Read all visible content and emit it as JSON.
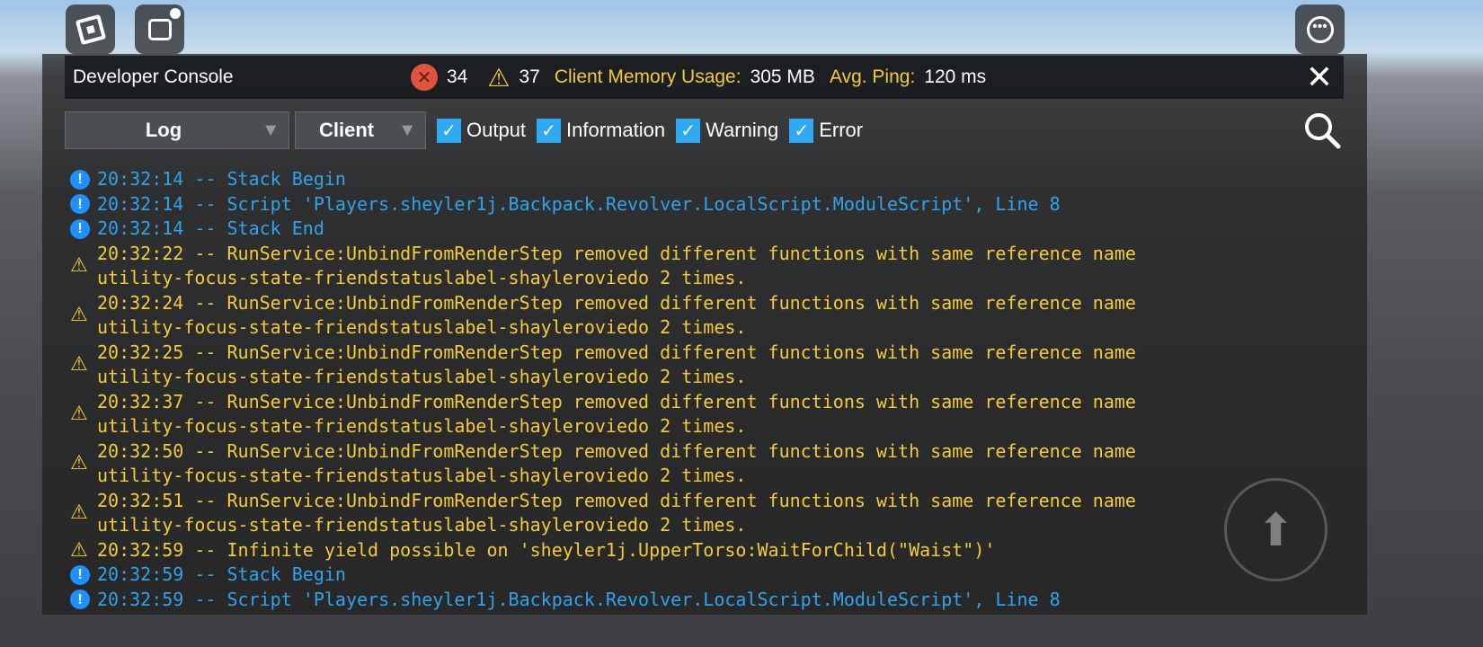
{
  "header": {
    "title": "Developer Console",
    "error_count": "34",
    "warning_count": "37",
    "memory_label": "Client Memory Usage:",
    "memory_value": "305 MB",
    "ping_label": "Avg. Ping:",
    "ping_value": "120 ms",
    "close": "✕"
  },
  "toolbar": {
    "view": "Log",
    "context": "Client",
    "filters": [
      "Output",
      "Information",
      "Warning",
      "Error"
    ]
  },
  "log": [
    {
      "type": "info",
      "lines": [
        "20:32:14 -- Stack Begin"
      ]
    },
    {
      "type": "info",
      "lines": [
        "20:32:14 -- Script 'Players.sheyler1j.Backpack.Revolver.LocalScript.ModuleScript', Line 8"
      ]
    },
    {
      "type": "info",
      "lines": [
        "20:32:14 -- Stack End"
      ]
    },
    {
      "type": "warn",
      "lines": [
        "20:32:22 -- RunService:UnbindFromRenderStep removed different functions with same reference name",
        "utility-focus-state-friendstatuslabel-shayleroviedo 2 times."
      ]
    },
    {
      "type": "warn",
      "lines": [
        "20:32:24 -- RunService:UnbindFromRenderStep removed different functions with same reference name",
        "utility-focus-state-friendstatuslabel-shayleroviedo 2 times."
      ]
    },
    {
      "type": "warn",
      "lines": [
        "20:32:25 -- RunService:UnbindFromRenderStep removed different functions with same reference name",
        "utility-focus-state-friendstatuslabel-shayleroviedo 2 times."
      ]
    },
    {
      "type": "warn",
      "lines": [
        "20:32:37 -- RunService:UnbindFromRenderStep removed different functions with same reference name",
        "utility-focus-state-friendstatuslabel-shayleroviedo 2 times."
      ]
    },
    {
      "type": "warn",
      "lines": [
        "20:32:50 -- RunService:UnbindFromRenderStep removed different functions with same reference name",
        "utility-focus-state-friendstatuslabel-shayleroviedo 2 times."
      ]
    },
    {
      "type": "warn",
      "lines": [
        "20:32:51 -- RunService:UnbindFromRenderStep removed different functions with same reference name",
        "utility-focus-state-friendstatuslabel-shayleroviedo 2 times."
      ]
    },
    {
      "type": "warn",
      "lines": [
        "20:32:59 -- Infinite yield possible on 'sheyler1j.UpperTorso:WaitForChild(\"Waist\")'"
      ]
    },
    {
      "type": "info",
      "lines": [
        "20:32:59 -- Stack Begin"
      ]
    },
    {
      "type": "info",
      "lines": [
        "20:32:59 -- Script 'Players.sheyler1j.Backpack.Revolver.LocalScript.ModuleScript', Line 8"
      ]
    }
  ]
}
